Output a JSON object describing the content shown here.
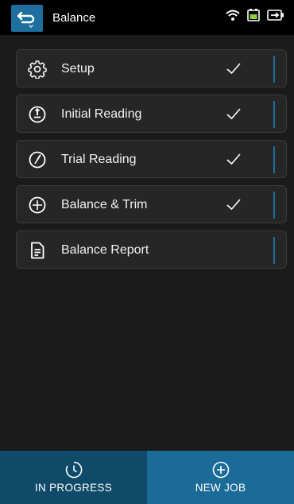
{
  "header": {
    "title": "Balance",
    "back_icon": "back-arrow-icon",
    "status_icons": [
      "wifi-icon",
      "battery-charging-icon",
      "power-plug-battery-icon"
    ],
    "accent": "#1f6f9e"
  },
  "steps": [
    {
      "label": "Setup",
      "icon": "gear-icon",
      "completed": true
    },
    {
      "label": "Initial Reading",
      "icon": "gauge-icon",
      "completed": true
    },
    {
      "label": "Trial Reading",
      "icon": "dial-icon",
      "completed": true
    },
    {
      "label": "Balance & Trim",
      "icon": "crosshair-icon",
      "completed": true
    },
    {
      "label": "Balance Report",
      "icon": "document-icon",
      "completed": false
    }
  ],
  "bottom_nav": {
    "tabs": [
      {
        "label": "IN PROGRESS",
        "icon": "clock-icon",
        "active": true,
        "color": "#0f4b68"
      },
      {
        "label": "NEW JOB",
        "icon": "plus-circle-icon",
        "active": false,
        "color": "#1b6b99"
      }
    ]
  }
}
